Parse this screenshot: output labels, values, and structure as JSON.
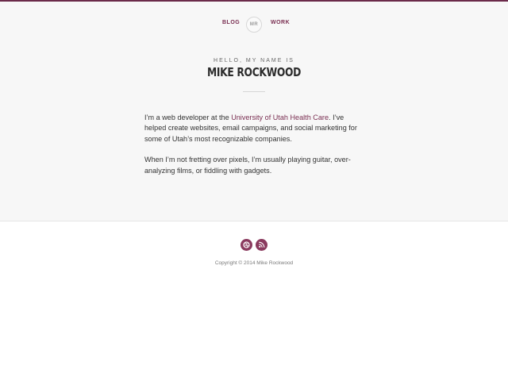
{
  "nav": {
    "blog_label": "BLOG",
    "logo_text": "MR",
    "work_label": "WORK"
  },
  "hero": {
    "greeting": "HELLO, MY NAME IS",
    "name": "MIKE ROCKWOOD"
  },
  "bio": {
    "p1_before": "I’m a web developer at the ",
    "p1_link": "University of Utah Health Care",
    "p1_after": ". I’ve helped create websites, email campaigns, and social marketing for some of Utah’s most recognizable companies.",
    "p2": "When I’m not fretting over pixels, I’m usually playing guitar, over-analyzing films, or fiddling with gadgets."
  },
  "footer": {
    "social": [
      {
        "name": "dribbble-icon"
      },
      {
        "name": "rss-icon"
      }
    ],
    "copyright": "Copyright © 2014 Mike Rockwood"
  },
  "colors": {
    "accent": "#7a2f52",
    "top_bar": "#6b2a4a",
    "hero_bg": "#f7f7f7",
    "text": "#333333"
  }
}
